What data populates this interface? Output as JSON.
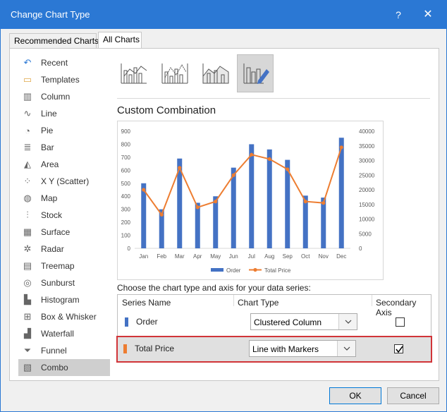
{
  "window": {
    "title": "Change Chart Type",
    "help": "?",
    "close": "✕"
  },
  "tabs": [
    {
      "label": "Recommended Charts"
    },
    {
      "label": "All Charts"
    }
  ],
  "sidebar": {
    "items": [
      {
        "label": "Recent",
        "icon": "recent-icon"
      },
      {
        "label": "Templates",
        "icon": "folder-icon"
      },
      {
        "label": "Column",
        "icon": "column-chart-icon"
      },
      {
        "label": "Line",
        "icon": "line-chart-icon"
      },
      {
        "label": "Pie",
        "icon": "pie-chart-icon"
      },
      {
        "label": "Bar",
        "icon": "bar-chart-icon"
      },
      {
        "label": "Area",
        "icon": "area-chart-icon"
      },
      {
        "label": "X Y (Scatter)",
        "icon": "scatter-chart-icon"
      },
      {
        "label": "Map",
        "icon": "map-chart-icon"
      },
      {
        "label": "Stock",
        "icon": "stock-chart-icon"
      },
      {
        "label": "Surface",
        "icon": "surface-chart-icon"
      },
      {
        "label": "Radar",
        "icon": "radar-chart-icon"
      },
      {
        "label": "Treemap",
        "icon": "treemap-chart-icon"
      },
      {
        "label": "Sunburst",
        "icon": "sunburst-chart-icon"
      },
      {
        "label": "Histogram",
        "icon": "histogram-chart-icon"
      },
      {
        "label": "Box & Whisker",
        "icon": "box-whisker-chart-icon"
      },
      {
        "label": "Waterfall",
        "icon": "waterfall-chart-icon"
      },
      {
        "label": "Funnel",
        "icon": "funnel-chart-icon"
      },
      {
        "label": "Combo",
        "icon": "combo-chart-icon"
      }
    ],
    "active_index": 18
  },
  "combo_types": [
    {
      "name": "clustered-column-line-icon"
    },
    {
      "name": "clustered-column-line-secondary-icon"
    },
    {
      "name": "stacked-area-clustered-column-icon"
    },
    {
      "name": "custom-combination-icon",
      "selected": true
    }
  ],
  "section_title": "Custom Combination",
  "chart_data": {
    "type": "bar",
    "categories": [
      "Jan",
      "Feb",
      "Mar",
      "Apr",
      "May",
      "Jun",
      "Jul",
      "Aug",
      "Sep",
      "Oct",
      "Nov",
      "Dec"
    ],
    "series": [
      {
        "name": "Order",
        "type": "bar",
        "axis": "primary",
        "color": "#4472c4",
        "values": [
          500,
          300,
          690,
          350,
          400,
          620,
          800,
          760,
          680,
          405,
          390,
          850
        ]
      },
      {
        "name": "Total Price",
        "type": "line-markers",
        "axis": "secondary",
        "color": "#ed7d31",
        "values": [
          20000,
          11500,
          27500,
          14000,
          16000,
          25000,
          32000,
          30500,
          27000,
          16000,
          15500,
          34500
        ]
      }
    ],
    "ylim": [
      0,
      900
    ],
    "y_ticks": [
      0,
      100,
      200,
      300,
      400,
      500,
      600,
      700,
      800,
      900
    ],
    "y2lim": [
      0,
      40000
    ],
    "y2_ticks": [
      0,
      5000,
      10000,
      15000,
      20000,
      25000,
      30000,
      35000,
      40000
    ],
    "grid": false,
    "legend": "bottom"
  },
  "series_section": {
    "prompt": "Choose the chart type and axis for your data series:",
    "headers": {
      "name": "Series Name",
      "type": "Chart Type",
      "axis": "Secondary Axis"
    },
    "rows": [
      {
        "name": "Order",
        "color": "#4472c4",
        "chart_type": "Clustered Column",
        "secondary": false,
        "selected": false
      },
      {
        "name": "Total Price",
        "color": "#ed7d31",
        "chart_type": "Line with Markers",
        "secondary": true,
        "selected": true
      }
    ]
  },
  "buttons": {
    "ok": "OK",
    "cancel": "Cancel"
  }
}
